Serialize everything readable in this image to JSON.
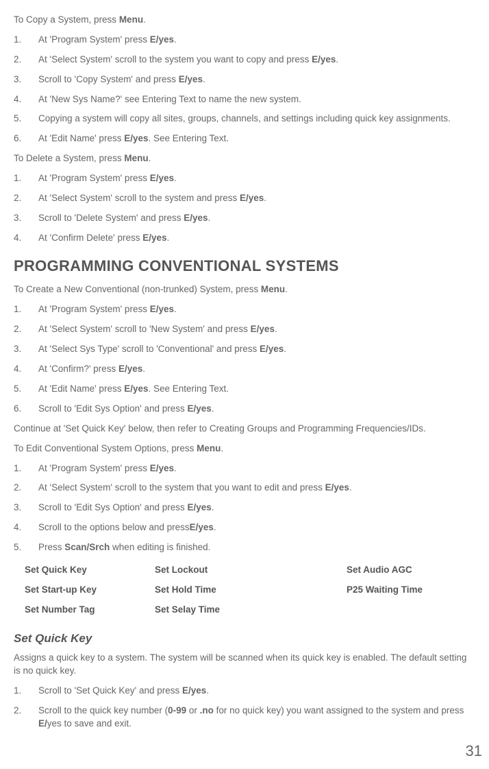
{
  "copyIntro": {
    "pre": "To Copy a System, press ",
    "b": "Menu",
    "post": "."
  },
  "copySteps": [
    {
      "n": "1.",
      "pre": "At 'Program System' press ",
      "b": "E/yes",
      "post": "."
    },
    {
      "n": "2.",
      "pre": "At 'Select System' scroll to the system you want to copy and press ",
      "b": "E/yes",
      "post": "."
    },
    {
      "n": "3.",
      "pre": "Scroll to 'Copy System' and press ",
      "b": "E/yes",
      "post": "."
    },
    {
      "n": "4.",
      "plain": "At 'New Sys Name?' see Entering Text to name the new system."
    },
    {
      "n": "5.",
      "plain": "Copying a system will copy all sites, groups, channels, and settings including quick key assignments."
    },
    {
      "n": "6.",
      "pre": "At 'Edit Name' press ",
      "b": "E/yes",
      "post": ". See Entering Text."
    }
  ],
  "deleteIntro": {
    "pre": "To Delete a System, press ",
    "b": "Menu",
    "post": "."
  },
  "deleteSteps": [
    {
      "n": "1.",
      "pre": "At 'Program System' press ",
      "b": "E/yes",
      "post": "."
    },
    {
      "n": "2.",
      "pre": "At 'Select System' scroll to the system and press ",
      "b": "E/yes",
      "post": "."
    },
    {
      "n": "3.",
      "pre": "Scroll to 'Delete System' and press ",
      "b": "E/yes",
      "post": "."
    },
    {
      "n": "4.",
      "pre": "At 'Confirm Delete' press ",
      "b": "E/yes",
      "post": "."
    }
  ],
  "heading1": "PROGRAMMING CONVENTIONAL SYSTEMS",
  "createIntro": {
    "pre": "To Create a New Conventional (non-trunked) System, press ",
    "b": "Menu",
    "post": "."
  },
  "createSteps": [
    {
      "n": "1.",
      "pre": "At 'Program System' press  ",
      "b": "E/yes",
      "post": "."
    },
    {
      "n": "2.",
      "pre": "At 'Select System' scroll to 'New System' and press  ",
      "b": "E/yes",
      "post": "."
    },
    {
      "n": "3.",
      "pre": "At 'Select Sys Type' scroll to 'Conventional' and press  ",
      "b": "E/yes",
      "post": "."
    },
    {
      "n": "4.",
      "pre": "At 'Confirm?' press  ",
      "b": "E/yes",
      "post": "."
    },
    {
      "n": "5.",
      "pre": "At 'Edit Name' press  ",
      "b": "E/yes",
      "post": ". See Entering Text."
    },
    {
      "n": "6.",
      "pre": "Scroll to 'Edit Sys Option' and press  ",
      "b": "E/yes",
      "post": "."
    }
  ],
  "continueText": "Continue at 'Set Quick Key' below, then refer to Creating Groups and Programming Frequencies/IDs.",
  "editIntro": {
    "pre": "To Edit Conventional System Options, press ",
    "b": "Menu",
    "post": "."
  },
  "editSteps": [
    {
      "n": "1.",
      "pre": "At 'Program System' press ",
      "b": "E/yes",
      "post": "."
    },
    {
      "n": "2.",
      "pre": "At 'Select System' scroll to the system that you want to edit and press ",
      "b": "E/yes",
      "post": "."
    },
    {
      "n": "3.",
      "pre": "Scroll to 'Edit Sys Option' and press ",
      "b": "E/yes",
      "post": "."
    },
    {
      "n": "4.",
      "pre": "Scroll to the options below and press",
      "b": "E/yes",
      "post": "."
    },
    {
      "n": "5.",
      "pre": "Press ",
      "b": "Scan/Srch",
      "post": " when editing is finished."
    }
  ],
  "optionsTable": {
    "col1": [
      "Set Quick Key",
      "Set Start-up Key",
      "Set Number Tag"
    ],
    "col2": [
      "Set Lockout",
      "Set Hold Time",
      "Set Selay Time"
    ],
    "col3": [
      "Set Audio AGC",
      "P25 Waiting Time"
    ]
  },
  "subheading": "Set Quick Key",
  "quickKeyDesc": "Assigns a quick key to a system. The system will be scanned when its quick key is enabled. The default setting is no quick key.",
  "quickKeySteps": [
    {
      "n": "1.",
      "pre": "Scroll to 'Set Quick Key' and press ",
      "b": "E/yes",
      "post": "."
    },
    {
      "n": "2.",
      "parts": [
        {
          "t": "Scroll to the quick key number ("
        },
        {
          "b": "0-99"
        },
        {
          "t": " or "
        },
        {
          "b": ".no"
        },
        {
          "t": " for no quick key) you want assigned to the system and press "
        },
        {
          "b": "E/"
        },
        {
          "t": "yes to save and exit."
        }
      ]
    }
  ],
  "pageNumber": "31"
}
